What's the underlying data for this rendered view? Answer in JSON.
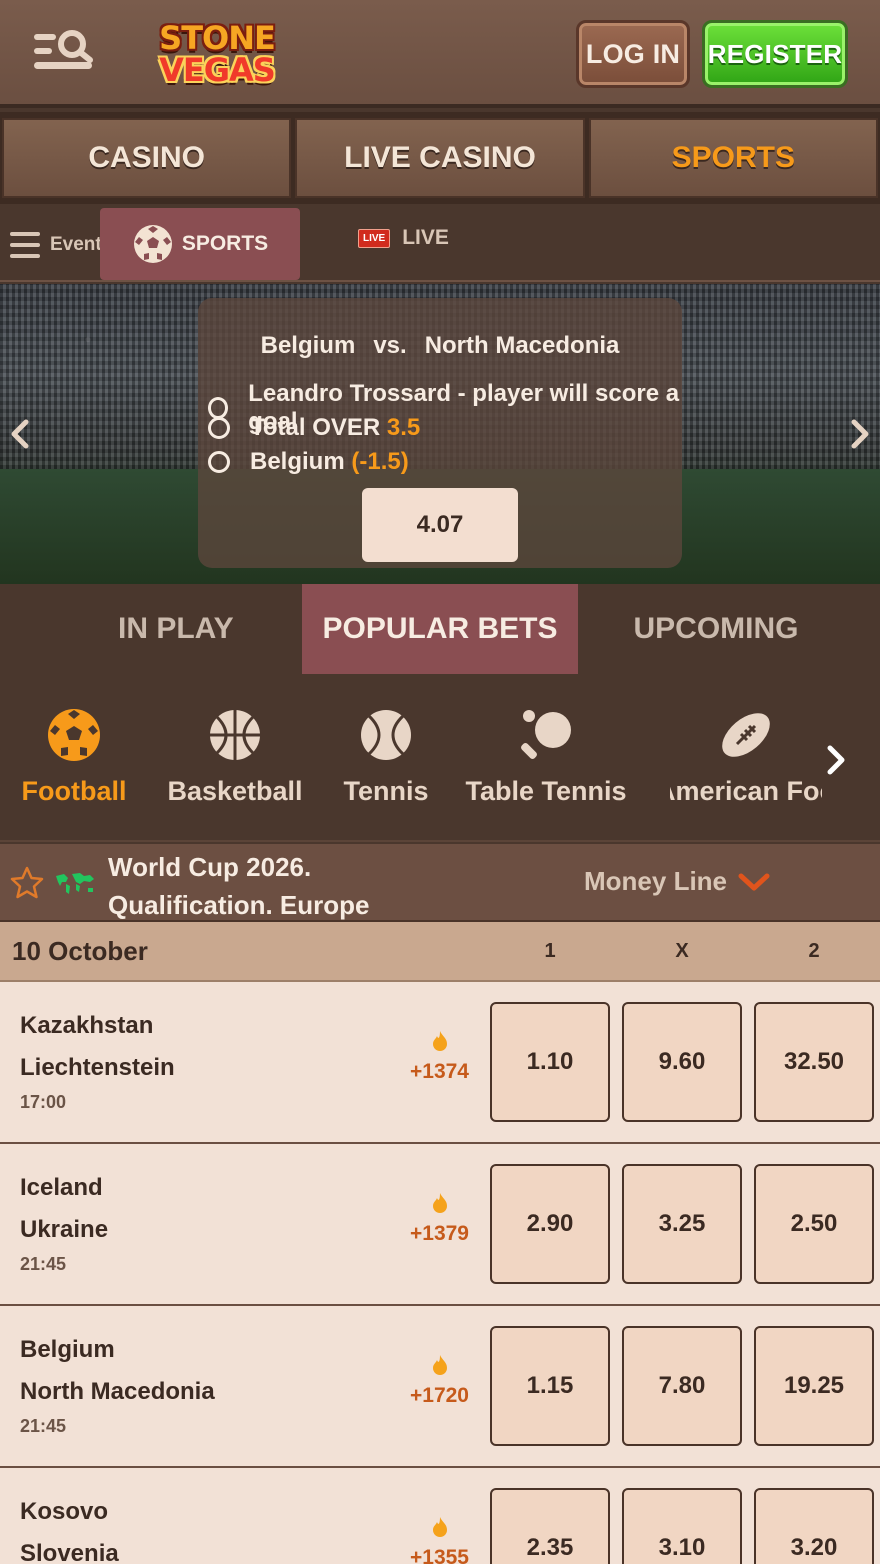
{
  "header": {
    "logo_top": "STONE",
    "logo_bottom": "VEGAS",
    "login_label": "LOG IN",
    "register_label": "REGISTER"
  },
  "top_tabs": [
    {
      "label": "CASINO"
    },
    {
      "label": "LIVE CASINO"
    },
    {
      "label": "SPORTS",
      "active": true
    }
  ],
  "subnav": {
    "events_label": "Events",
    "sports_label": "SPORTS",
    "live_badge": "LIVE",
    "live_label": "LIVE"
  },
  "hero": {
    "team_home": "Belgium",
    "vs": "vs.",
    "team_away": "North Macedonia",
    "selections": [
      {
        "text": "Leandro Trossard - player will score a goal",
        "highlight": ""
      },
      {
        "text": "Total OVER",
        "highlight": "3.5"
      },
      {
        "text": "Belgium",
        "highlight": "(-1.5)"
      }
    ],
    "odds": "4.07"
  },
  "bet_tabs": [
    {
      "label": "IN PLAY"
    },
    {
      "label": "POPULAR BETS",
      "active": true
    },
    {
      "label": "UPCOMING"
    }
  ],
  "sports": [
    {
      "label": "Football",
      "icon": "football-icon",
      "active": true
    },
    {
      "label": "Basketball",
      "icon": "basketball-icon"
    },
    {
      "label": "Tennis",
      "icon": "tennis-ball-icon"
    },
    {
      "label": "Table Tennis",
      "icon": "table-tennis-icon"
    },
    {
      "label": "American Foo",
      "icon": "american-football-icon"
    }
  ],
  "league": {
    "name_line1": "World Cup 2026.",
    "name_line2": "Qualification. Europe",
    "market": "Money Line"
  },
  "date_row": {
    "date": "10 October",
    "col1": "1",
    "colx": "X",
    "col2": "2"
  },
  "matches": [
    {
      "home": "Kazakhstan",
      "away": "Liechtenstein",
      "time": "17:00",
      "markets": "+1374",
      "odds": [
        "1.10",
        "9.60",
        "32.50"
      ]
    },
    {
      "home": "Iceland",
      "away": "Ukraine",
      "time": "21:45",
      "markets": "+1379",
      "odds": [
        "2.90",
        "3.25",
        "2.50"
      ]
    },
    {
      "home": "Belgium",
      "away": "North Macedonia",
      "time": "21:45",
      "markets": "+1720",
      "odds": [
        "1.15",
        "7.80",
        "19.25"
      ]
    },
    {
      "home": "Kosovo",
      "away": "Slovenia",
      "time": "",
      "markets": "+1355",
      "odds": [
        "2.35",
        "3.10",
        "3.20"
      ]
    }
  ],
  "colors": {
    "accent_orange": "#f79a1a",
    "active_tab": "#8a4e52",
    "register_green": "#2fa415",
    "odds_button": "#f1d6c3"
  }
}
